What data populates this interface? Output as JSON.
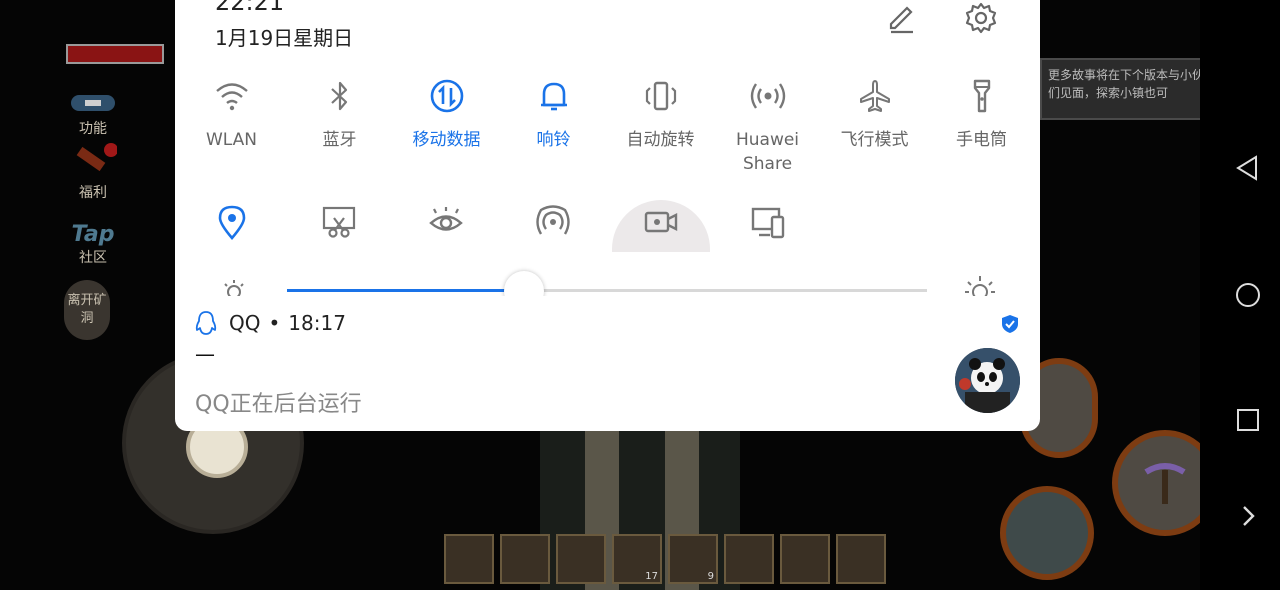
{
  "status": {
    "time": "22:21",
    "date": "1月19日星期日"
  },
  "quick_settings": {
    "row1": [
      {
        "label": "WLAN",
        "icon": "wifi-icon",
        "active": false
      },
      {
        "label": "蓝牙",
        "icon": "bluetooth-icon",
        "active": false
      },
      {
        "label": "移动数据",
        "icon": "mobile-data-icon",
        "active": true
      },
      {
        "label": "响铃",
        "icon": "bell-icon",
        "active": true
      },
      {
        "label": "自动旋转",
        "icon": "auto-rotate-icon",
        "active": false
      },
      {
        "label": "Huawei\nShare",
        "icon": "huawei-share-icon",
        "active": false
      },
      {
        "label": "飞行模式",
        "icon": "airplane-icon",
        "active": false
      },
      {
        "label": "手电筒",
        "icon": "flashlight-icon",
        "active": false
      }
    ],
    "row2": [
      {
        "icon": "location-icon",
        "active": true
      },
      {
        "icon": "screenshot-icon",
        "active": false
      },
      {
        "icon": "eye-comfort-icon",
        "active": false
      },
      {
        "icon": "hotspot-icon",
        "active": false
      },
      {
        "icon": "screen-record-icon",
        "active": true
      },
      {
        "icon": "multi-screen-icon",
        "active": false
      }
    ],
    "brightness_level": 0.37
  },
  "notification": {
    "app": "QQ",
    "separator": "•",
    "time": "18:17",
    "title": "—",
    "body": "QQ正在后台运行"
  },
  "game": {
    "hud_function": "功能",
    "hud_welfare": "福利",
    "hud_tap": "Tap",
    "hud_community": "社区",
    "hud_leave": "离开矿洞",
    "story_text": "更多故事将在下个版本与小伙伴们见面，探索小镇也可",
    "slot_counts": [
      "17",
      "9"
    ]
  },
  "colors": {
    "accent": "#1a73e8",
    "inactive_icon": "#777777"
  }
}
